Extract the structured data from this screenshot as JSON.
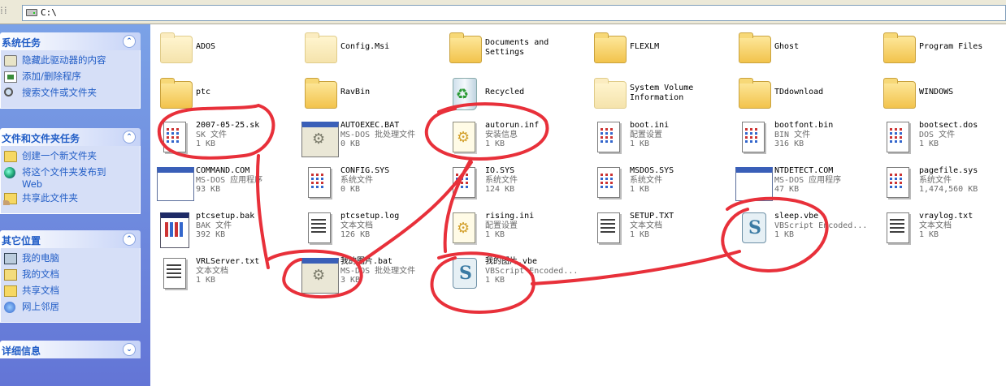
{
  "address": {
    "path": "C:\\"
  },
  "sidebar": {
    "system_tasks": {
      "title": "系统任务",
      "items": [
        "隐藏此驱动器的内容",
        "添加/删除程序",
        "搜索文件或文件夹"
      ]
    },
    "file_tasks": {
      "title": "文件和文件夹任务",
      "items": [
        "创建一个新文件夹",
        "将这个文件夹发布到",
        "Web",
        "共享此文件夹"
      ]
    },
    "other_places": {
      "title": "其它位置",
      "items": [
        "我的电脑",
        "我的文档",
        "共享文档",
        "网上邻居"
      ]
    },
    "details": {
      "title": "详细信息"
    },
    "toggle_up": "⌃",
    "toggle_down": "⌄"
  },
  "files": [
    {
      "name": "ADOS",
      "icon": "folder-faint-icon"
    },
    {
      "name": "Config.Msi",
      "icon": "folder-faint-icon"
    },
    {
      "name": "Documents and",
      "name2": "Settings",
      "icon": "folder-icon"
    },
    {
      "name": "FLEXLM",
      "icon": "folder-icon"
    },
    {
      "name": "Ghost",
      "icon": "folder-icon"
    },
    {
      "name": "Program Files",
      "icon": "folder-icon"
    },
    {
      "name": "ptc",
      "icon": "folder-icon"
    },
    {
      "name": "RavBin",
      "icon": "folder-icon"
    },
    {
      "name": "Recycled",
      "icon": "recycle-bin-icon"
    },
    {
      "name": "System Volume",
      "name2": "Information",
      "icon": "folder-faint-icon"
    },
    {
      "name": "TDdownload",
      "icon": "folder-icon"
    },
    {
      "name": "WINDOWS",
      "icon": "folder-icon"
    },
    {
      "name": "2007-05-25.sk",
      "type": "SK 文件",
      "size": "1 KB",
      "icon": "grid-doc-icon"
    },
    {
      "name": "AUTOEXEC.BAT",
      "type": "MS-DOS 批处理文件",
      "size": "0 KB",
      "icon": "batch-file-icon"
    },
    {
      "name": "autorun.inf",
      "type": "安装信息",
      "size": "1 KB",
      "icon": "config-file-icon"
    },
    {
      "name": "boot.ini",
      "type": "配置设置",
      "size": "1 KB",
      "icon": "grid-doc-icon"
    },
    {
      "name": "bootfont.bin",
      "type": "BIN 文件",
      "size": "316 KB",
      "icon": "grid-doc-icon"
    },
    {
      "name": "bootsect.dos",
      "type": "DOS 文件",
      "size": "1 KB",
      "icon": "grid-doc-icon"
    },
    {
      "name": "COMMAND.COM",
      "type": "MS-DOS 应用程序",
      "size": "93 KB",
      "icon": "app-window-icon"
    },
    {
      "name": "CONFIG.SYS",
      "type": "系统文件",
      "size": "0 KB",
      "icon": "grid-doc-icon"
    },
    {
      "name": "IO.SYS",
      "type": "系统文件",
      "size": "124 KB",
      "icon": "grid-doc-icon"
    },
    {
      "name": "MSDOS.SYS",
      "type": "系统文件",
      "size": "1 KB",
      "icon": "grid-doc-icon"
    },
    {
      "name": "NTDETECT.COM",
      "type": "MS-DOS 应用程序",
      "size": "47 KB",
      "icon": "app-window-icon"
    },
    {
      "name": "pagefile.sys",
      "type": "系统文件",
      "size": "1,474,560 KB",
      "icon": "grid-doc-icon"
    },
    {
      "name": "ptcsetup.bak",
      "type": "BAK 文件",
      "size": "392 KB",
      "icon": "bak-file-icon"
    },
    {
      "name": "ptcsetup.log",
      "type": "文本文档",
      "size": "126 KB",
      "icon": "text-doc-icon"
    },
    {
      "name": "rising.ini",
      "type": "配置设置",
      "size": "1 KB",
      "icon": "config-file-icon"
    },
    {
      "name": "SETUP.TXT",
      "type": "文本文档",
      "size": "1 KB",
      "icon": "text-doc-icon"
    },
    {
      "name": "sleep.vbe",
      "type": "VBScript Encoded...",
      "size": "1 KB",
      "icon": "vbscript-icon"
    },
    {
      "name": "vraylog.txt",
      "type": "文本文档",
      "size": "1 KB",
      "icon": "text-doc-icon"
    },
    {
      "name": "VRLServer.txt",
      "type": "文本文档",
      "size": "1 KB",
      "icon": "text-doc-icon"
    },
    {
      "name": "我的图片.bat",
      "type": "MS-DOS 批处理文件",
      "size": "3 KB",
      "icon": "batch-file-icon"
    },
    {
      "name": "我的图片.vbe",
      "type": "VBScript Encoded...",
      "size": "1 KB",
      "icon": "vbscript-icon"
    }
  ],
  "annotation_color": "#e8303a"
}
